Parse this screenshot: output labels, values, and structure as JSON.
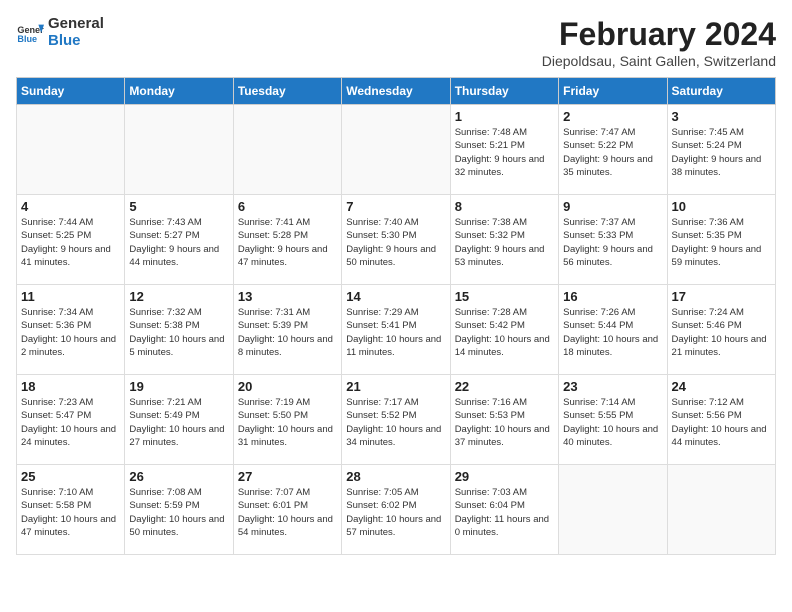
{
  "header": {
    "logo_general": "General",
    "logo_blue": "Blue",
    "month_year": "February 2024",
    "location": "Diepoldsau, Saint Gallen, Switzerland"
  },
  "weekdays": [
    "Sunday",
    "Monday",
    "Tuesday",
    "Wednesday",
    "Thursday",
    "Friday",
    "Saturday"
  ],
  "weeks": [
    [
      {
        "day": "",
        "info": ""
      },
      {
        "day": "",
        "info": ""
      },
      {
        "day": "",
        "info": ""
      },
      {
        "day": "",
        "info": ""
      },
      {
        "day": "1",
        "info": "Sunrise: 7:48 AM\nSunset: 5:21 PM\nDaylight: 9 hours\nand 32 minutes."
      },
      {
        "day": "2",
        "info": "Sunrise: 7:47 AM\nSunset: 5:22 PM\nDaylight: 9 hours\nand 35 minutes."
      },
      {
        "day": "3",
        "info": "Sunrise: 7:45 AM\nSunset: 5:24 PM\nDaylight: 9 hours\nand 38 minutes."
      }
    ],
    [
      {
        "day": "4",
        "info": "Sunrise: 7:44 AM\nSunset: 5:25 PM\nDaylight: 9 hours\nand 41 minutes."
      },
      {
        "day": "5",
        "info": "Sunrise: 7:43 AM\nSunset: 5:27 PM\nDaylight: 9 hours\nand 44 minutes."
      },
      {
        "day": "6",
        "info": "Sunrise: 7:41 AM\nSunset: 5:28 PM\nDaylight: 9 hours\nand 47 minutes."
      },
      {
        "day": "7",
        "info": "Sunrise: 7:40 AM\nSunset: 5:30 PM\nDaylight: 9 hours\nand 50 minutes."
      },
      {
        "day": "8",
        "info": "Sunrise: 7:38 AM\nSunset: 5:32 PM\nDaylight: 9 hours\nand 53 minutes."
      },
      {
        "day": "9",
        "info": "Sunrise: 7:37 AM\nSunset: 5:33 PM\nDaylight: 9 hours\nand 56 minutes."
      },
      {
        "day": "10",
        "info": "Sunrise: 7:36 AM\nSunset: 5:35 PM\nDaylight: 9 hours\nand 59 minutes."
      }
    ],
    [
      {
        "day": "11",
        "info": "Sunrise: 7:34 AM\nSunset: 5:36 PM\nDaylight: 10 hours\nand 2 minutes."
      },
      {
        "day": "12",
        "info": "Sunrise: 7:32 AM\nSunset: 5:38 PM\nDaylight: 10 hours\nand 5 minutes."
      },
      {
        "day": "13",
        "info": "Sunrise: 7:31 AM\nSunset: 5:39 PM\nDaylight: 10 hours\nand 8 minutes."
      },
      {
        "day": "14",
        "info": "Sunrise: 7:29 AM\nSunset: 5:41 PM\nDaylight: 10 hours\nand 11 minutes."
      },
      {
        "day": "15",
        "info": "Sunrise: 7:28 AM\nSunset: 5:42 PM\nDaylight: 10 hours\nand 14 minutes."
      },
      {
        "day": "16",
        "info": "Sunrise: 7:26 AM\nSunset: 5:44 PM\nDaylight: 10 hours\nand 18 minutes."
      },
      {
        "day": "17",
        "info": "Sunrise: 7:24 AM\nSunset: 5:46 PM\nDaylight: 10 hours\nand 21 minutes."
      }
    ],
    [
      {
        "day": "18",
        "info": "Sunrise: 7:23 AM\nSunset: 5:47 PM\nDaylight: 10 hours\nand 24 minutes."
      },
      {
        "day": "19",
        "info": "Sunrise: 7:21 AM\nSunset: 5:49 PM\nDaylight: 10 hours\nand 27 minutes."
      },
      {
        "day": "20",
        "info": "Sunrise: 7:19 AM\nSunset: 5:50 PM\nDaylight: 10 hours\nand 31 minutes."
      },
      {
        "day": "21",
        "info": "Sunrise: 7:17 AM\nSunset: 5:52 PM\nDaylight: 10 hours\nand 34 minutes."
      },
      {
        "day": "22",
        "info": "Sunrise: 7:16 AM\nSunset: 5:53 PM\nDaylight: 10 hours\nand 37 minutes."
      },
      {
        "day": "23",
        "info": "Sunrise: 7:14 AM\nSunset: 5:55 PM\nDaylight: 10 hours\nand 40 minutes."
      },
      {
        "day": "24",
        "info": "Sunrise: 7:12 AM\nSunset: 5:56 PM\nDaylight: 10 hours\nand 44 minutes."
      }
    ],
    [
      {
        "day": "25",
        "info": "Sunrise: 7:10 AM\nSunset: 5:58 PM\nDaylight: 10 hours\nand 47 minutes."
      },
      {
        "day": "26",
        "info": "Sunrise: 7:08 AM\nSunset: 5:59 PM\nDaylight: 10 hours\nand 50 minutes."
      },
      {
        "day": "27",
        "info": "Sunrise: 7:07 AM\nSunset: 6:01 PM\nDaylight: 10 hours\nand 54 minutes."
      },
      {
        "day": "28",
        "info": "Sunrise: 7:05 AM\nSunset: 6:02 PM\nDaylight: 10 hours\nand 57 minutes."
      },
      {
        "day": "29",
        "info": "Sunrise: 7:03 AM\nSunset: 6:04 PM\nDaylight: 11 hours\nand 0 minutes."
      },
      {
        "day": "",
        "info": ""
      },
      {
        "day": "",
        "info": ""
      }
    ]
  ]
}
